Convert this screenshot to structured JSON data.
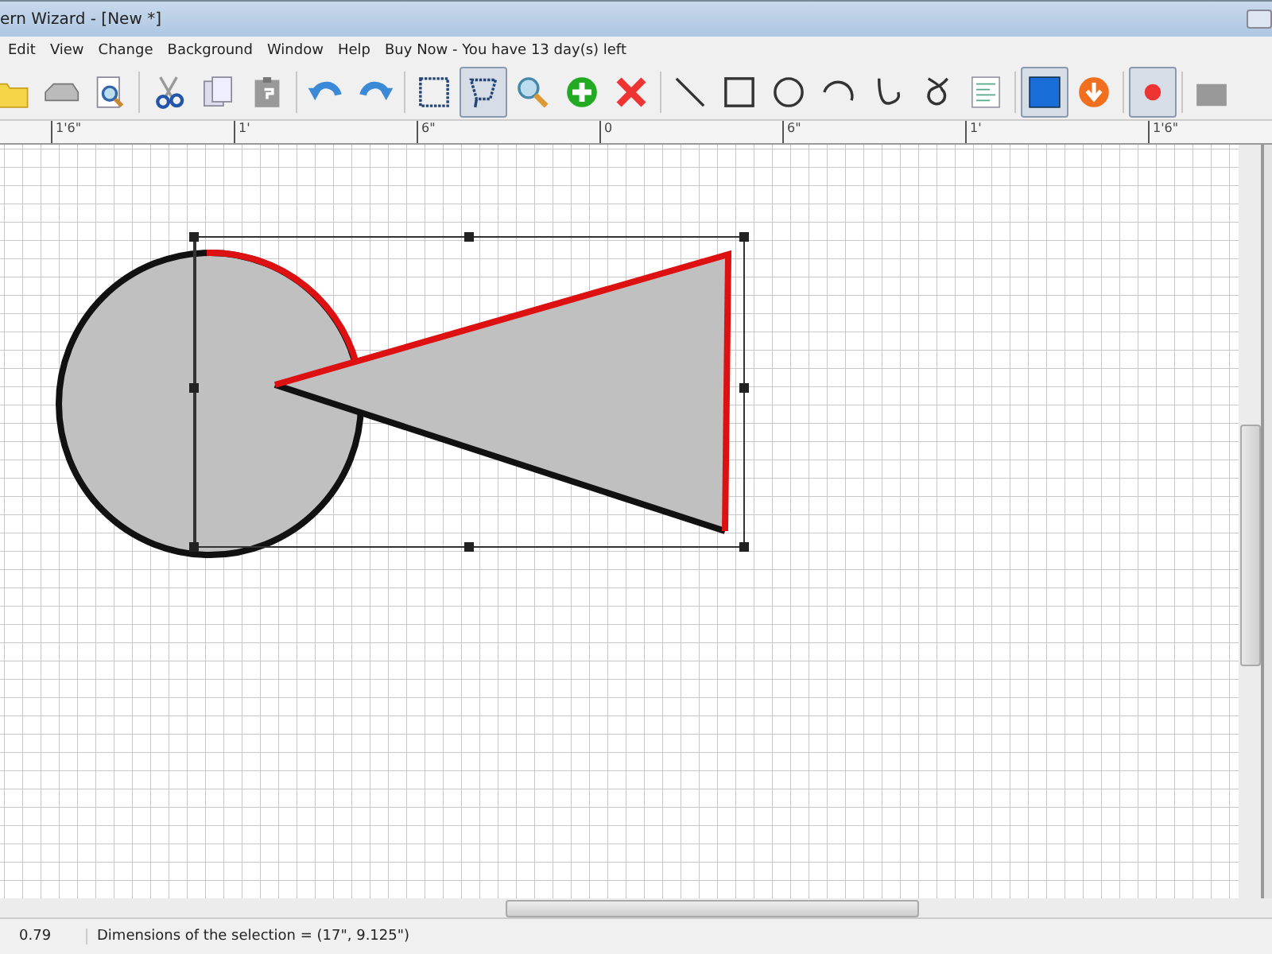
{
  "window": {
    "title": "ern Wizard - [New *]"
  },
  "menu": [
    "Edit",
    "View",
    "Change",
    "Background",
    "Window",
    "Help",
    "Buy Now - You have 13 day(s) left"
  ],
  "toolbar": [
    {
      "kind": "folder",
      "selected": false
    },
    {
      "kind": "drive",
      "selected": false
    },
    {
      "kind": "preview",
      "selected": false
    },
    {
      "kind": "sep"
    },
    {
      "kind": "scissors",
      "selected": false
    },
    {
      "kind": "copy",
      "selected": false
    },
    {
      "kind": "paste",
      "selected": false
    },
    {
      "kind": "sep"
    },
    {
      "kind": "undo",
      "selected": false
    },
    {
      "kind": "redo",
      "selected": false
    },
    {
      "kind": "sep"
    },
    {
      "kind": "rect-select",
      "selected": false
    },
    {
      "kind": "lasso",
      "selected": true
    },
    {
      "kind": "zoom",
      "selected": false
    },
    {
      "kind": "add",
      "selected": false
    },
    {
      "kind": "delete",
      "selected": false
    },
    {
      "kind": "sep"
    },
    {
      "kind": "line",
      "selected": false
    },
    {
      "kind": "square",
      "selected": false
    },
    {
      "kind": "circle",
      "selected": false
    },
    {
      "kind": "arc",
      "selected": false
    },
    {
      "kind": "hook",
      "selected": false
    },
    {
      "kind": "loop",
      "selected": false
    },
    {
      "kind": "text",
      "selected": false
    },
    {
      "kind": "sep"
    },
    {
      "kind": "fill",
      "selected": true
    },
    {
      "kind": "down",
      "selected": false
    },
    {
      "kind": "sep"
    },
    {
      "kind": "dot",
      "selected": true
    },
    {
      "kind": "sep"
    },
    {
      "kind": "grey",
      "selected": false
    }
  ],
  "ruler": [
    "1'6\"",
    "1'",
    "6\"",
    "0",
    "6\"",
    "1'",
    "1'6\""
  ],
  "canvas": {
    "shapes": [
      {
        "kind": "circle"
      },
      {
        "kind": "triangle"
      }
    ],
    "selected": true
  },
  "status_bar": {
    "zoom": "0.79",
    "message": "Dimensions of the selection = (17\", 9.125\")"
  }
}
